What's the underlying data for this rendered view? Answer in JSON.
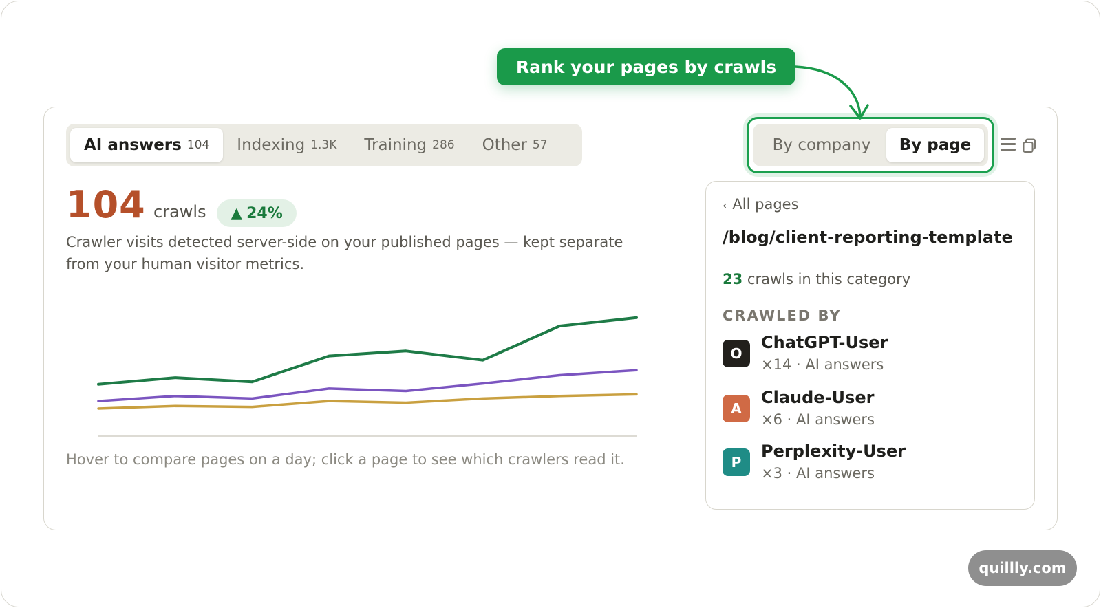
{
  "callout": {
    "text": "Rank your pages by crawls"
  },
  "tabs": [
    {
      "label": "AI answers",
      "count": "104",
      "active": true
    },
    {
      "label": "Indexing",
      "count": "1.3K",
      "active": false
    },
    {
      "label": "Training",
      "count": "286",
      "active": false
    },
    {
      "label": "Other",
      "count": "57",
      "active": false
    }
  ],
  "view_toggle": {
    "company": "By company",
    "page": "By page",
    "selected": "page"
  },
  "summary": {
    "value": "104",
    "unit": "crawls",
    "delta": "24%",
    "description": "Crawler visits detected server-side on your published pages — kept separate from your human visitor metrics."
  },
  "chart_data": {
    "type": "line",
    "title": "",
    "xlabel": "",
    "ylabel": "",
    "x": [
      1,
      2,
      3,
      4,
      5,
      6,
      7,
      8
    ],
    "series": [
      {
        "color": "#1e7b47",
        "values": [
          6.2,
          7.0,
          6.5,
          9.6,
          10.2,
          9.1,
          13.2,
          14.2
        ]
      },
      {
        "color": "#7b55c0",
        "values": [
          4.2,
          4.8,
          4.5,
          5.7,
          5.4,
          6.3,
          7.3,
          7.9
        ]
      },
      {
        "color": "#c9a040",
        "values": [
          3.3,
          3.6,
          3.5,
          4.2,
          4.0,
          4.5,
          4.8,
          5.0
        ]
      }
    ],
    "ylim": [
      0,
      16
    ],
    "grid": false,
    "legend": "none",
    "hint": "Hover to compare pages on a day; click a page to see which crawlers read it."
  },
  "detail": {
    "back_label": "All pages",
    "path": "/blog/client-reporting-template",
    "crawl_count": "23",
    "crawl_count_label": "crawls in this category",
    "crawled_by_heading": "CRAWLED BY",
    "bots": [
      {
        "initial": "O",
        "name": "ChatGPT-User",
        "sub": "×14 · AI answers",
        "color": "#22201c"
      },
      {
        "initial": "A",
        "name": "Claude-User",
        "sub": "×6 · AI answers",
        "color": "#d06a45"
      },
      {
        "initial": "P",
        "name": "Perplexity-User",
        "sub": "×3 · AI answers",
        "color": "#1f8c86"
      }
    ]
  },
  "brand": {
    "text": "quillly.com"
  },
  "icons": {
    "list": "list-icon",
    "copy": "copy-icon",
    "back": "chevron-left-icon"
  },
  "colors": {
    "accent_green": "#1a9a4a",
    "number_orange": "#b5502a"
  }
}
